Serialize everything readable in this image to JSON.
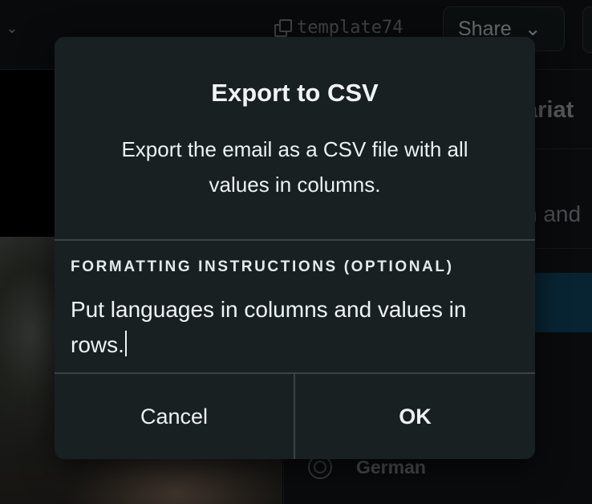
{
  "background": {
    "template_name": "template74",
    "share_label": "Share",
    "right_panel_heading_fragment": "ariat",
    "right_panel_text_fragment": "n and",
    "language_option": "German"
  },
  "dialog": {
    "title": "Export to CSV",
    "description": "Export the email as a CSV file with all values in columns.",
    "field_label": "FORMATTING INSTRUCTIONS (OPTIONAL)",
    "field_value": "Put languages in columns and values in rows.",
    "cancel_label": "Cancel",
    "ok_label": "OK"
  },
  "icons": {
    "copy": "copy-icon",
    "chevron": "chevron-down-icon",
    "radio": "radio-icon"
  },
  "colors": {
    "dialog_bg": "#182022",
    "accent_blue": "#0f3f58"
  }
}
